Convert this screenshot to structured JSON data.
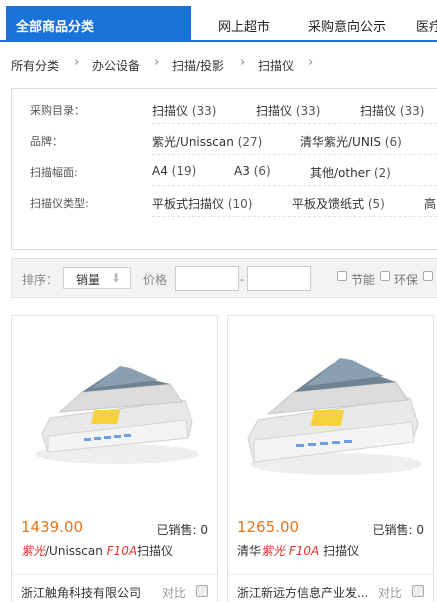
{
  "nav": {
    "all_categories": "全部商品分类",
    "links": [
      "网上超市",
      "采购意向公示",
      "医疗"
    ]
  },
  "breadcrumb": [
    "所有分类",
    "办公设备",
    "扫描/投影",
    "扫描仪"
  ],
  "filters": {
    "catalog": {
      "label": "采购目录：",
      "options": [
        {
          "name": "扫描仪",
          "count": "(33)"
        },
        {
          "name": "扫描仪",
          "count": "(33)"
        },
        {
          "name": "扫描仪",
          "count": "(33)"
        }
      ]
    },
    "brand": {
      "label": "品牌：",
      "options": [
        {
          "name": "紫光/Unisscan",
          "count": "(27)"
        },
        {
          "name": "清华紫光/UNIS",
          "count": "(6)"
        }
      ]
    },
    "width": {
      "label": "扫描幅面:",
      "options": [
        {
          "name": "A4",
          "count": "(19)"
        },
        {
          "name": "A3",
          "count": "(6)"
        },
        {
          "name": "其他/other",
          "count": "(2)"
        }
      ]
    },
    "type": {
      "label": "扫描仪类型:",
      "options": [
        {
          "name": "平板式扫描仪",
          "count": "(10)"
        },
        {
          "name": "平板及馈纸式",
          "count": "(5)"
        },
        {
          "name": "高",
          "count": ""
        }
      ]
    }
  },
  "sortbar": {
    "sort_label": "排序：",
    "sort_value": "销量",
    "price_label": "价格",
    "price_dash": "-",
    "checks": [
      "节能",
      "环保"
    ]
  },
  "products": [
    {
      "price": "1439.00",
      "sold": "已销售: 0",
      "title_hl1": "紫光",
      "title_mid": "/Unisscan ",
      "title_hl2": "F10A",
      "title_end": "扫描仪",
      "vendor": "浙江触角科技有限公司",
      "compare": "对比"
    },
    {
      "price": "1265.00",
      "sold": "已销售: 0",
      "title_pre": "清华",
      "title_hl1": "紫光",
      "title_mid": " ",
      "title_hl2": "F10A",
      "title_end": " 扫描仪",
      "vendor": "浙江新远方信息产业发...",
      "compare": "对比"
    }
  ],
  "colors": {
    "brand_blue": "#1a73d9",
    "price_orange": "#e8741b",
    "highlight_red": "#e03434"
  }
}
